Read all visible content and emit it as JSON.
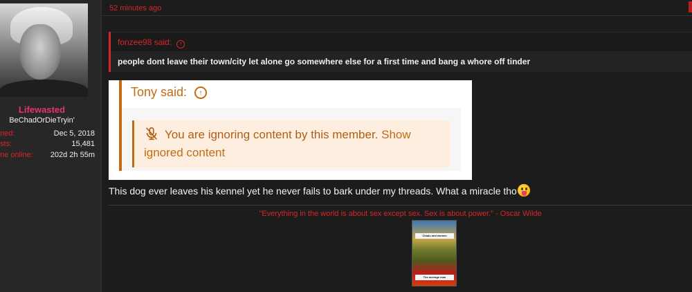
{
  "user": {
    "name": "Lifewasted",
    "title": "BeChadOrDieTryin'",
    "stats": [
      {
        "label": "ned:",
        "value": "Dec 5, 2018"
      },
      {
        "label": "sts:",
        "value": "15,481"
      },
      {
        "label": "ne online:",
        "value": "202d 2h 55m"
      }
    ]
  },
  "post": {
    "time": "52 minutes ago",
    "quote": {
      "author_label": "fonzee98 said:",
      "text": "people dont leave their town/city let alone go somewhere else for a first time and bang a whore off tinder"
    },
    "embedded_quote": {
      "author_label": "Tony said:",
      "ignore_text": "You are ignoring content by this member.",
      "show_label": "Show ignored content"
    },
    "body": "This dog ever leaves his kennel yet he never fails to bark under my threads. What a miracle tho",
    "signature": "\"Everything in the world is about sex except sex. Sex is about power.\" - Oscar Wilde",
    "sig_image": {
      "caption_top": "Chads and women",
      "caption_bottom": "The average man"
    }
  },
  "colors": {
    "accent_red": "#d8262a",
    "username_pink": "#e8316f",
    "quote_orange": "#c46a13"
  }
}
